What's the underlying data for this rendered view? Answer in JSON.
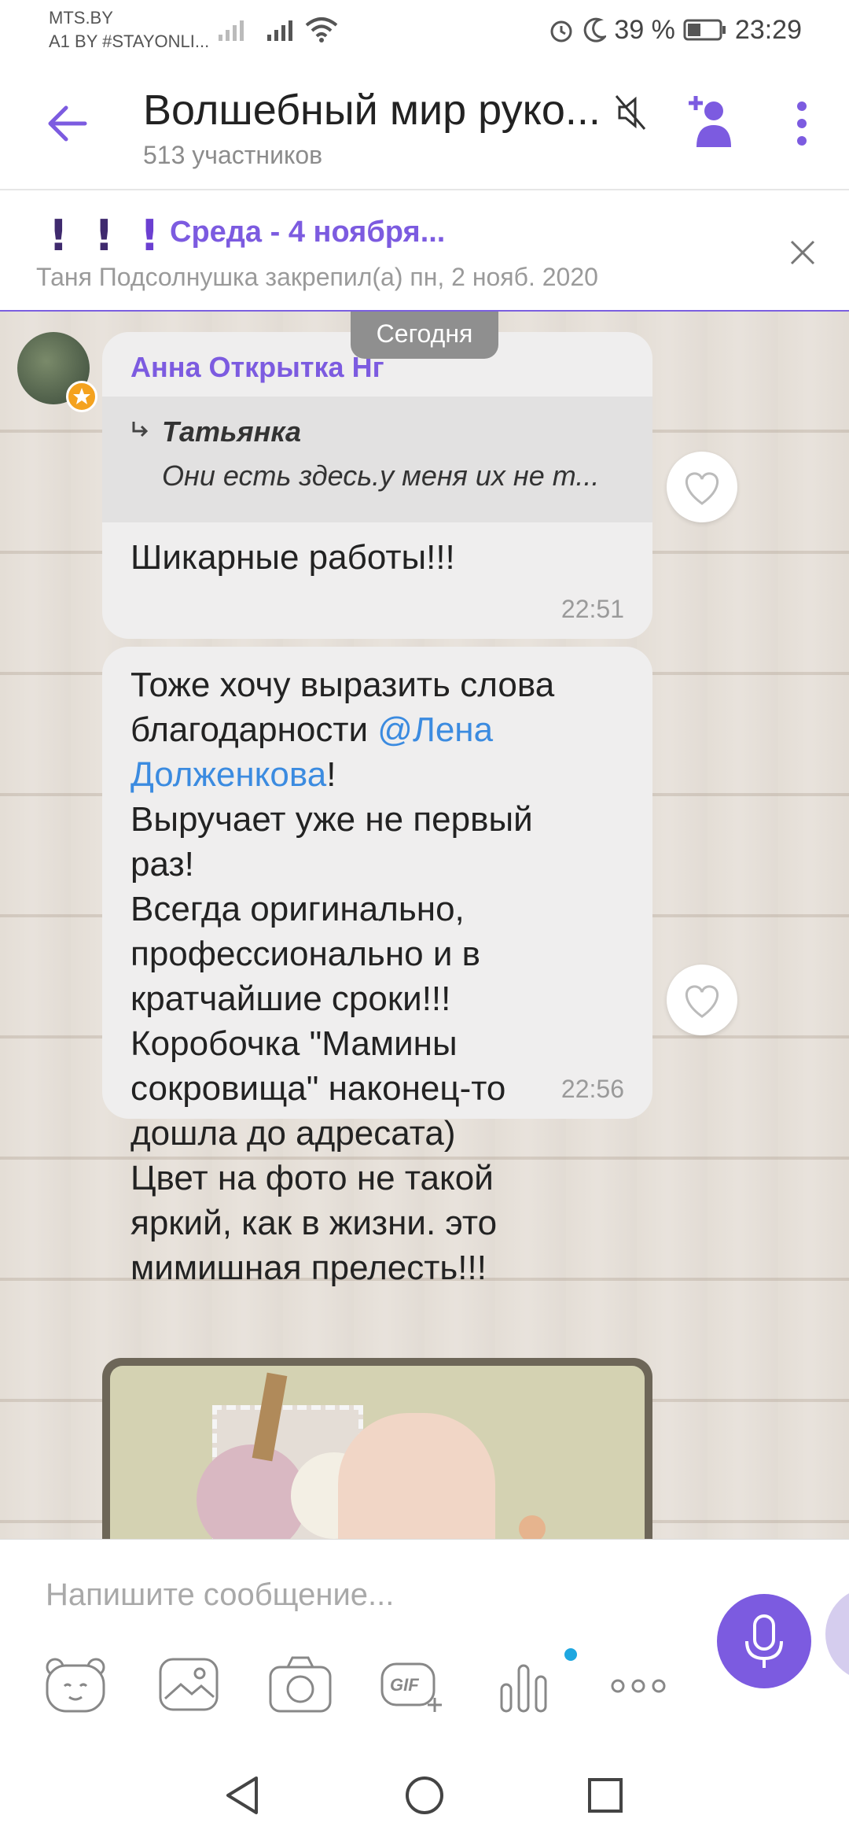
{
  "status_bar": {
    "carrier1": "MTS.BY",
    "carrier2": "A1 BY #STAYONLI...",
    "battery": "39 %",
    "time": "23:29"
  },
  "header": {
    "title": "Волшебный мир руко...",
    "members": "513 участников"
  },
  "pinned": {
    "title": "Среда - 4 ноября...",
    "subtitle": "Таня Подсолнушка закрепил(а) пн, 2 нояб. 2020"
  },
  "chat": {
    "date_label": "Сегодня",
    "messages": [
      {
        "sender": "Анна Открытка Нг",
        "quote_author": "Татьянка",
        "quote_text": "Они есть здесь.у меня их не т...",
        "text": "Шикарные работы!!!",
        "time": "22:51"
      },
      {
        "line1": "Тоже хочу выразить слова",
        "line2_pre": "благодарности ",
        "mention_part1": "@Лена",
        "mention_part2": "Долженкова",
        "line3_post": "!",
        "rest": [
          "Выручает уже не первый",
          "раз!",
          "Всегда оригинально,",
          "профессионально и в",
          "кратчайшие сроки!!!",
          "Коробочка \"Мамины",
          "сокровища\" наконец-то",
          "дошла до адресата)",
          "Цвет на фото не такой",
          "яркий, как в жизни. это",
          "мимишная прелесть!!!"
        ],
        "time": "22:56"
      }
    ]
  },
  "composer": {
    "placeholder": "Напишите сообщение..."
  },
  "colors": {
    "accent": "#7c5be0",
    "mention": "#3b8be0",
    "bubble": "#efeeee"
  },
  "icons": [
    "back-arrow-icon",
    "mute-icon",
    "add-member-icon",
    "more-vert-icon",
    "close-icon",
    "heart-icon",
    "sticker-icon",
    "gallery-icon",
    "camera-icon",
    "gif-icon",
    "poll-icon",
    "more-horiz-icon",
    "mic-icon",
    "nav-back-icon",
    "nav-home-icon",
    "nav-recents-icon",
    "signal-icon",
    "wifi-icon",
    "alarm-icon",
    "moon-icon",
    "battery-icon"
  ]
}
